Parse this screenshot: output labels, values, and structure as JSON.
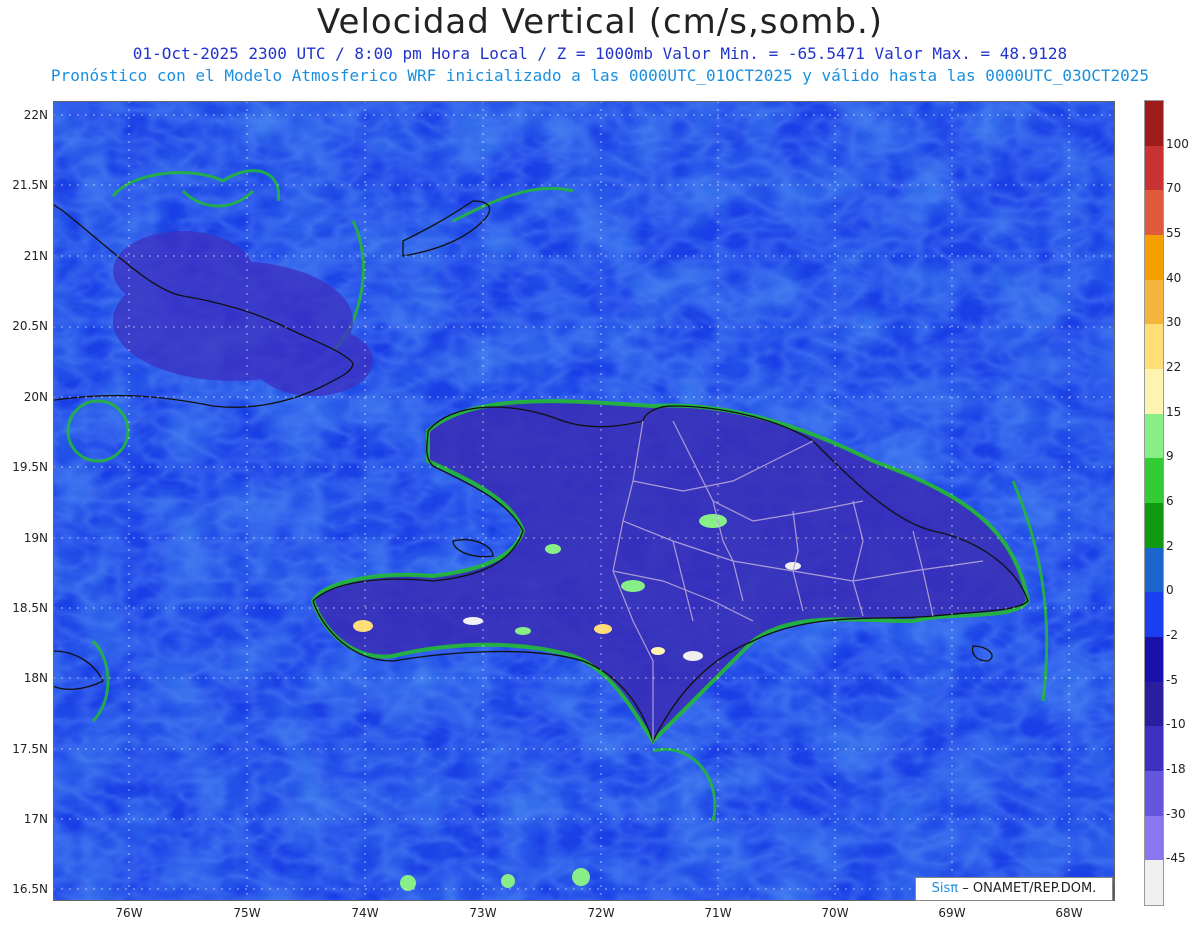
{
  "title": "Velocidad Vertical (cm/s,somb.)",
  "subtitle_line1": "01-Oct-2025  2300 UTC / 8:00 pm Hora Local / Z = 1000mb  Valor Min. = -65.5471  Valor Max. = 48.9128",
  "subtitle_line2": "Pronóstico con el Modelo Atmosferico WRF inicializado a las 0000UTC_01OCT2025 y válido hasta las  0000UTC_03OCT2025",
  "lat_labels": [
    "22N",
    "21.5N",
    "21N",
    "20.5N",
    "20N",
    "19.5N",
    "19N",
    "18.5N",
    "18N",
    "17.5N",
    "17N",
    "16.5N"
  ],
  "lon_labels": [
    "76W",
    "75W",
    "74W",
    "73W",
    "72W",
    "71W",
    "70W",
    "69W",
    "68W"
  ],
  "colorbar": {
    "labels": [
      "100",
      "70",
      "55",
      "40",
      "30",
      "22",
      "15",
      "9",
      "6",
      "2",
      "0",
      "-2",
      "-5",
      "-10",
      "-18",
      "-30",
      "-45"
    ],
    "colors": [
      "#9e1b1b",
      "#c83232",
      "#e05a3c",
      "#f5a000",
      "#f5b53c",
      "#ffdd77",
      "#fff3b0",
      "#88ee88",
      "#33cc33",
      "#119911",
      "#1a66cc",
      "#1a3ff0",
      "#1a12a8",
      "#2a1e9e",
      "#3d2fc0",
      "#6655dd",
      "#8877ee",
      "#f0f0f0"
    ]
  },
  "credit": {
    "logo": "Sisπ",
    "text": "– ONAMET/REP.DOM."
  }
}
